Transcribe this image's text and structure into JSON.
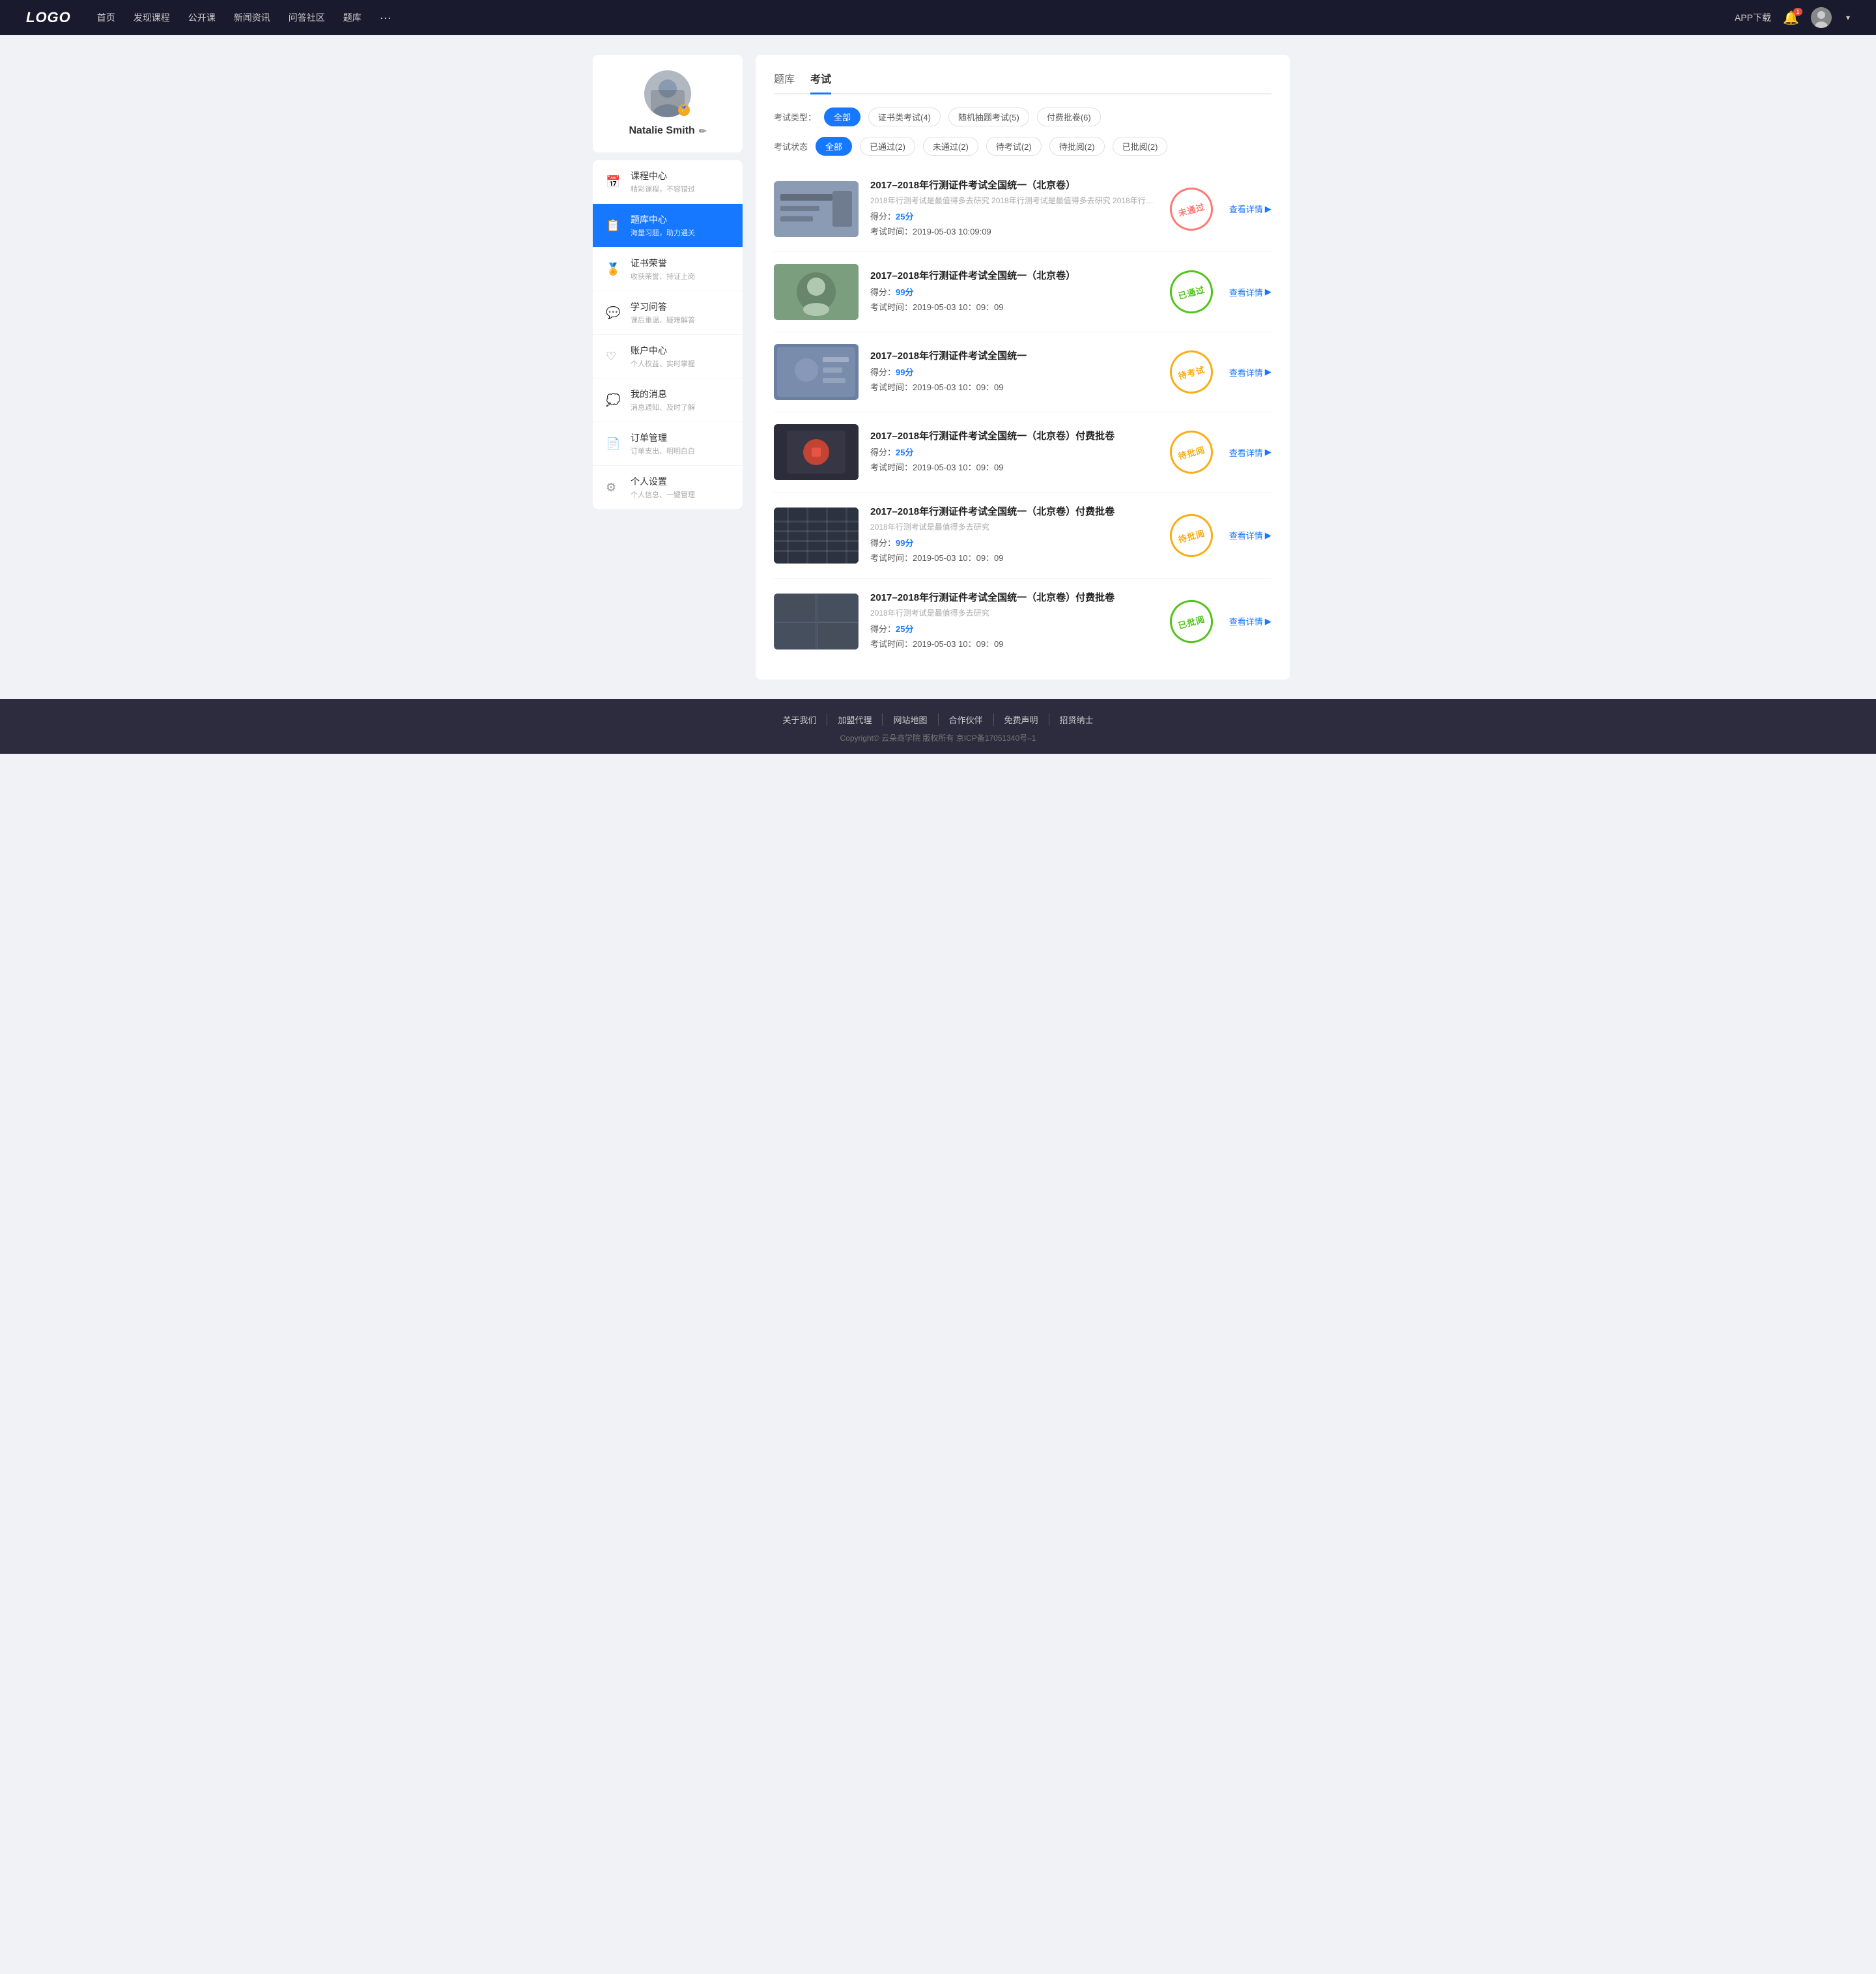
{
  "nav": {
    "logo": "LOGO",
    "links": [
      "首页",
      "发现课程",
      "公开课",
      "新闻资讯",
      "问答社区",
      "题库"
    ],
    "more": "···",
    "app_download": "APP下载",
    "bell_badge": "1",
    "user_chevron": "▾"
  },
  "sidebar": {
    "profile": {
      "name": "Natalie Smith",
      "edit_icon": "✏"
    },
    "menu": [
      {
        "id": "course",
        "icon": "📅",
        "label": "课程中心",
        "sub": "精彩课程，不容错过"
      },
      {
        "id": "question",
        "icon": "📋",
        "label": "题库中心",
        "sub": "海量习题，助力通关"
      },
      {
        "id": "cert",
        "icon": "🏅",
        "label": "证书荣誉",
        "sub": "收获荣誉、持证上岗"
      },
      {
        "id": "qa",
        "icon": "💬",
        "label": "学习问答",
        "sub": "课后重温、疑难解答"
      },
      {
        "id": "account",
        "icon": "♡",
        "label": "账户中心",
        "sub": "个人权益、实时掌握"
      },
      {
        "id": "msg",
        "icon": "💭",
        "label": "我的消息",
        "sub": "消息通知、及时了解"
      },
      {
        "id": "order",
        "icon": "📄",
        "label": "订单管理",
        "sub": "订单支出、明明白白"
      },
      {
        "id": "settings",
        "icon": "⚙",
        "label": "个人设置",
        "sub": "个人信息、一键管理"
      }
    ]
  },
  "content": {
    "tabs": [
      "题库",
      "考试"
    ],
    "active_tab": "考试",
    "filter_type_label": "考试类型：",
    "filter_types": [
      {
        "label": "全部",
        "active": true
      },
      {
        "label": "证书类考试(4)",
        "active": false
      },
      {
        "label": "随机抽题考试(5)",
        "active": false
      },
      {
        "label": "付费批卷(6)",
        "active": false
      }
    ],
    "filter_status_label": "考试状态",
    "filter_statuses": [
      {
        "label": "全部",
        "active": true
      },
      {
        "label": "已通过(2)",
        "active": false
      },
      {
        "label": "未通过(2)",
        "active": false
      },
      {
        "label": "待考试(2)",
        "active": false
      },
      {
        "label": "待批阅(2)",
        "active": false
      },
      {
        "label": "已批阅(2)",
        "active": false
      }
    ],
    "exams": [
      {
        "id": 1,
        "title": "2017–2018年行测证件考试全国统一（北京卷）",
        "desc": "2018年行测考试是最值得多去研究 2018年行测考试是最值得多去研究 2018年行…",
        "score_label": "得分：",
        "score": "25分",
        "time_label": "考试时间：",
        "time": "2019-05-03  10:09:09",
        "stamp_text": "未通过",
        "stamp_type": "not-passed",
        "detail_label": "查看详情",
        "thumb_color": "#8b9bb4"
      },
      {
        "id": 2,
        "title": "2017–2018年行测证件考试全国统一（北京卷）",
        "desc": "",
        "score_label": "得分：",
        "score": "99分",
        "time_label": "考试时间：",
        "time": "2019-05-03  10：09：09",
        "stamp_text": "已通过",
        "stamp_type": "passed",
        "detail_label": "查看详情",
        "thumb_color": "#7a9e7e"
      },
      {
        "id": 3,
        "title": "2017–2018年行测证件考试全国统一",
        "desc": "",
        "score_label": "得分：",
        "score": "99分",
        "time_label": "考试时间：",
        "time": "2019-05-03  10：09：09",
        "stamp_text": "待考试",
        "stamp_type": "pending",
        "detail_label": "查看详情",
        "thumb_color": "#6b7fa3"
      },
      {
        "id": 4,
        "title": "2017–2018年行测证件考试全国统一（北京卷）付费批卷",
        "desc": "",
        "score_label": "得分：",
        "score": "25分",
        "time_label": "考试时间：",
        "time": "2019-05-03  10：09：09",
        "stamp_text": "待批阅",
        "stamp_type": "pending-review",
        "detail_label": "查看详情",
        "thumb_color": "#3a3a4a"
      },
      {
        "id": 5,
        "title": "2017–2018年行测证件考试全国统一（北京卷）付费批卷",
        "desc": "2018年行测考试是最值得多去研究",
        "score_label": "得分：",
        "score": "99分",
        "time_label": "考试时间：",
        "time": "2019-05-03  10：09：09",
        "stamp_text": "待批阅",
        "stamp_type": "pending-review",
        "detail_label": "查看详情",
        "thumb_color": "#2d3240"
      },
      {
        "id": 6,
        "title": "2017–2018年行测证件考试全国统一（北京卷）付费批卷",
        "desc": "2018年行测考试是最值得多去研究",
        "score_label": "得分：",
        "score": "25分",
        "time_label": "考试时间：",
        "time": "2019-05-03  10：09：09",
        "stamp_text": "已批阅",
        "stamp_type": "reviewed",
        "detail_label": "查看详情",
        "thumb_color": "#4a5568"
      }
    ]
  },
  "footer": {
    "links": [
      "关于我们",
      "加盟代理",
      "网站地图",
      "合作伙伴",
      "免费声明",
      "招贤纳士"
    ],
    "copyright": "Copyright© 云朵商学院  版权所有    京ICP备17051340号–1"
  }
}
